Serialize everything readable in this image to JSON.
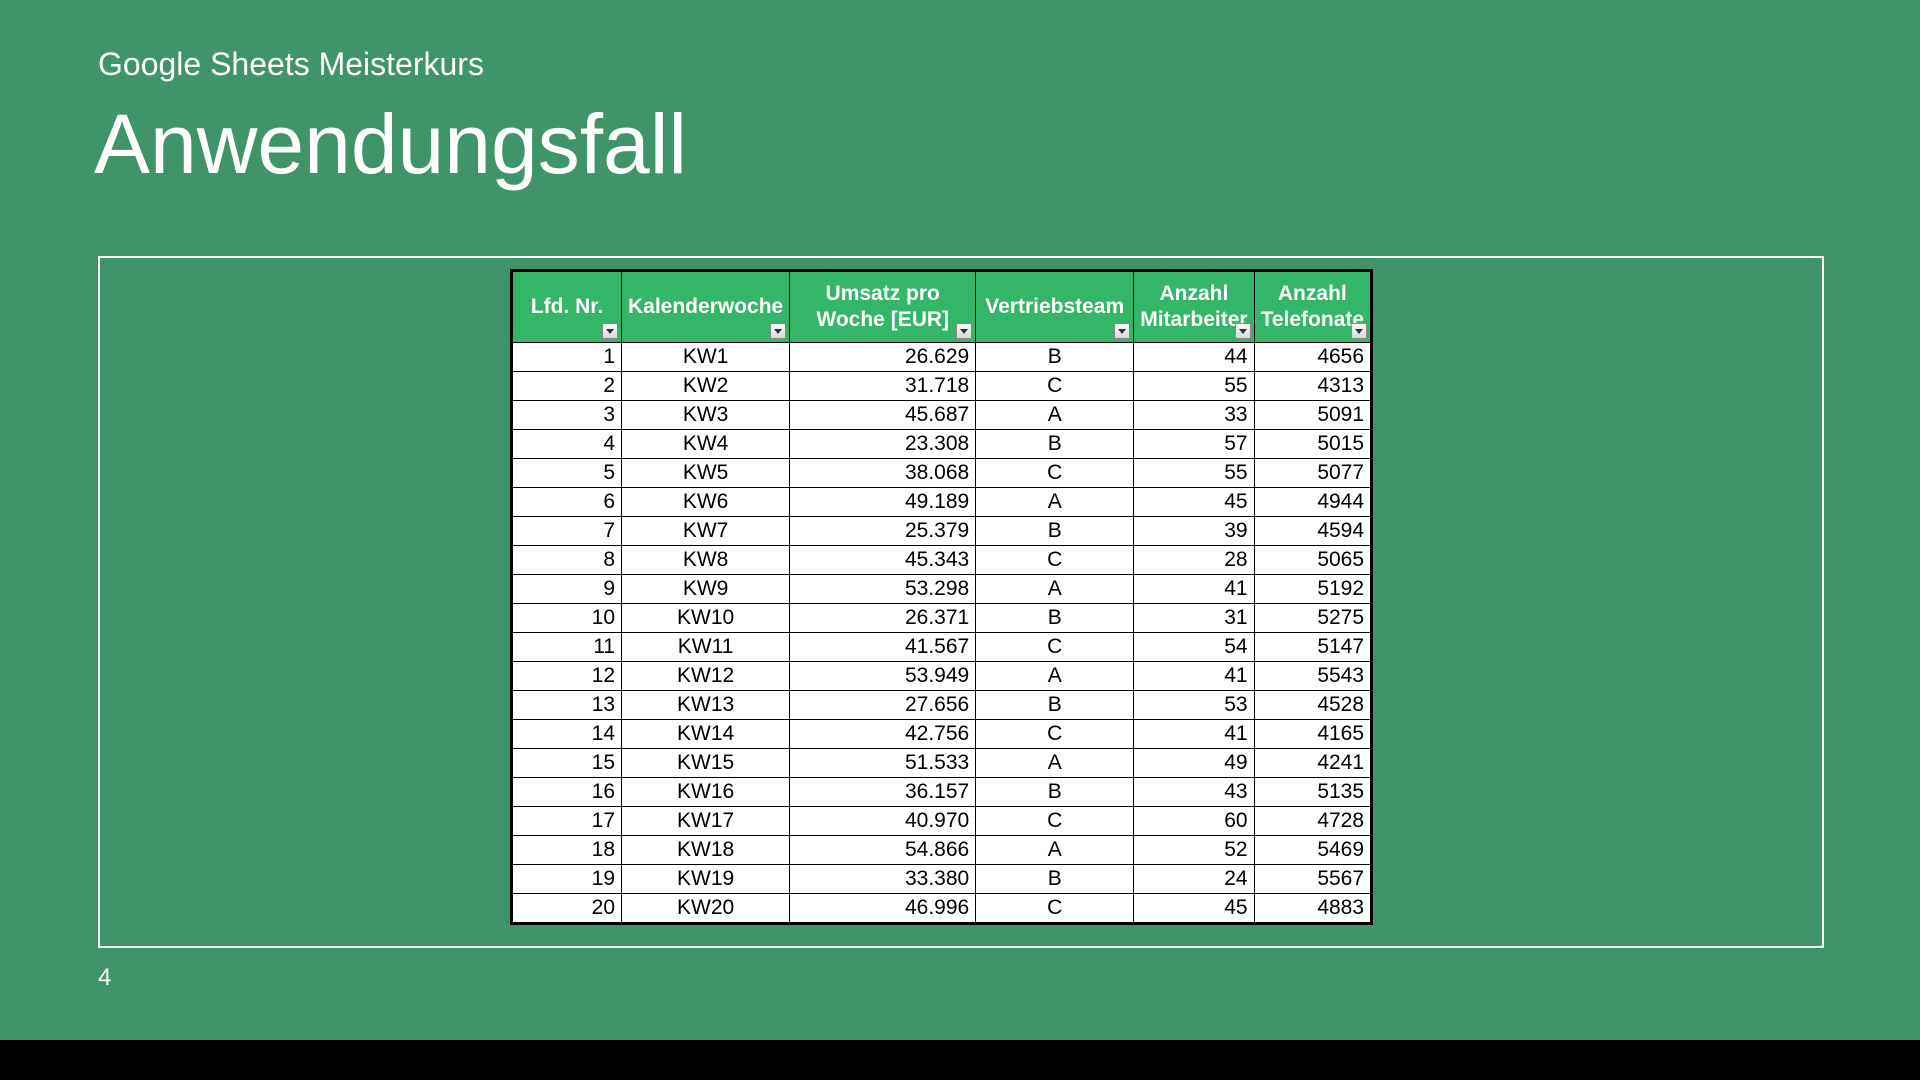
{
  "subtitle": "Google Sheets Meisterkurs",
  "title": "Anwendungsfall",
  "page_number": "4",
  "table": {
    "headers": [
      "Lfd. Nr.",
      "Kalenderwoche",
      "Umsatz pro Woche [EUR]",
      "Vertriebsteam",
      "Anzahl Mitarbeiter",
      "Anzahl Telefonate"
    ],
    "rows": [
      {
        "nr": "1",
        "kw": "KW1",
        "umsatz": "26.629",
        "team": "B",
        "ma": "44",
        "tel": "4656"
      },
      {
        "nr": "2",
        "kw": "KW2",
        "umsatz": "31.718",
        "team": "C",
        "ma": "55",
        "tel": "4313"
      },
      {
        "nr": "3",
        "kw": "KW3",
        "umsatz": "45.687",
        "team": "A",
        "ma": "33",
        "tel": "5091"
      },
      {
        "nr": "4",
        "kw": "KW4",
        "umsatz": "23.308",
        "team": "B",
        "ma": "57",
        "tel": "5015"
      },
      {
        "nr": "5",
        "kw": "KW5",
        "umsatz": "38.068",
        "team": "C",
        "ma": "55",
        "tel": "5077"
      },
      {
        "nr": "6",
        "kw": "KW6",
        "umsatz": "49.189",
        "team": "A",
        "ma": "45",
        "tel": "4944"
      },
      {
        "nr": "7",
        "kw": "KW7",
        "umsatz": "25.379",
        "team": "B",
        "ma": "39",
        "tel": "4594"
      },
      {
        "nr": "8",
        "kw": "KW8",
        "umsatz": "45.343",
        "team": "C",
        "ma": "28",
        "tel": "5065"
      },
      {
        "nr": "9",
        "kw": "KW9",
        "umsatz": "53.298",
        "team": "A",
        "ma": "41",
        "tel": "5192"
      },
      {
        "nr": "10",
        "kw": "KW10",
        "umsatz": "26.371",
        "team": "B",
        "ma": "31",
        "tel": "5275"
      },
      {
        "nr": "11",
        "kw": "KW11",
        "umsatz": "41.567",
        "team": "C",
        "ma": "54",
        "tel": "5147"
      },
      {
        "nr": "12",
        "kw": "KW12",
        "umsatz": "53.949",
        "team": "A",
        "ma": "41",
        "tel": "5543"
      },
      {
        "nr": "13",
        "kw": "KW13",
        "umsatz": "27.656",
        "team": "B",
        "ma": "53",
        "tel": "4528"
      },
      {
        "nr": "14",
        "kw": "KW14",
        "umsatz": "42.756",
        "team": "C",
        "ma": "41",
        "tel": "4165"
      },
      {
        "nr": "15",
        "kw": "KW15",
        "umsatz": "51.533",
        "team": "A",
        "ma": "49",
        "tel": "4241"
      },
      {
        "nr": "16",
        "kw": "KW16",
        "umsatz": "36.157",
        "team": "B",
        "ma": "43",
        "tel": "5135"
      },
      {
        "nr": "17",
        "kw": "KW17",
        "umsatz": "40.970",
        "team": "C",
        "ma": "60",
        "tel": "4728"
      },
      {
        "nr": "18",
        "kw": "KW18",
        "umsatz": "54.866",
        "team": "A",
        "ma": "52",
        "tel": "5469"
      },
      {
        "nr": "19",
        "kw": "KW19",
        "umsatz": "33.380",
        "team": "B",
        "ma": "24",
        "tel": "5567"
      },
      {
        "nr": "20",
        "kw": "KW20",
        "umsatz": "46.996",
        "team": "C",
        "ma": "45",
        "tel": "4883"
      }
    ]
  }
}
